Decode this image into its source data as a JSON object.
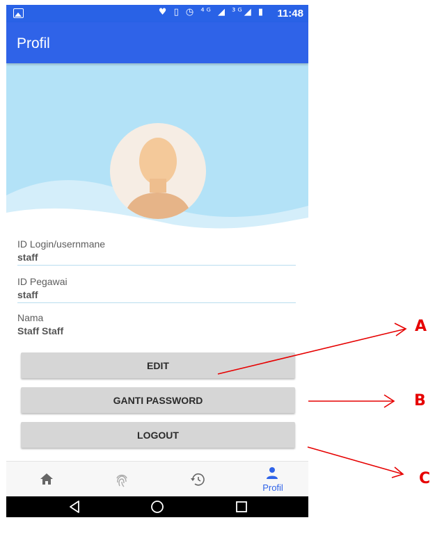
{
  "status_bar": {
    "icons": "♥ ▯ ◷ ⁴ᴳ ◢ ³ᴳ◢ ▮",
    "time": "11:48"
  },
  "app_bar": {
    "title": "Profil"
  },
  "profile": {
    "fields": [
      {
        "label": "ID Login/usernmane",
        "value": "staff"
      },
      {
        "label": "ID Pegawai",
        "value": "staff"
      },
      {
        "label": "Nama",
        "value": "Staff Staff"
      }
    ]
  },
  "buttons": {
    "edit": "EDIT",
    "ganti_password": "GANTI PASSWORD",
    "logout": "LOGOUT"
  },
  "bottom_nav": {
    "items": [
      {
        "icon": "home-icon"
      },
      {
        "icon": "fingerprint-icon"
      },
      {
        "icon": "history-icon"
      },
      {
        "icon": "person-icon",
        "label": "Profil",
        "active": true
      }
    ]
  },
  "annotations": {
    "a": "A",
    "b": "B",
    "c": "C"
  },
  "colors": {
    "primary": "#2f63e8",
    "header_bg": "#b3e2f7",
    "button_bg": "#d6d6d6",
    "annotation": "#e60000"
  }
}
